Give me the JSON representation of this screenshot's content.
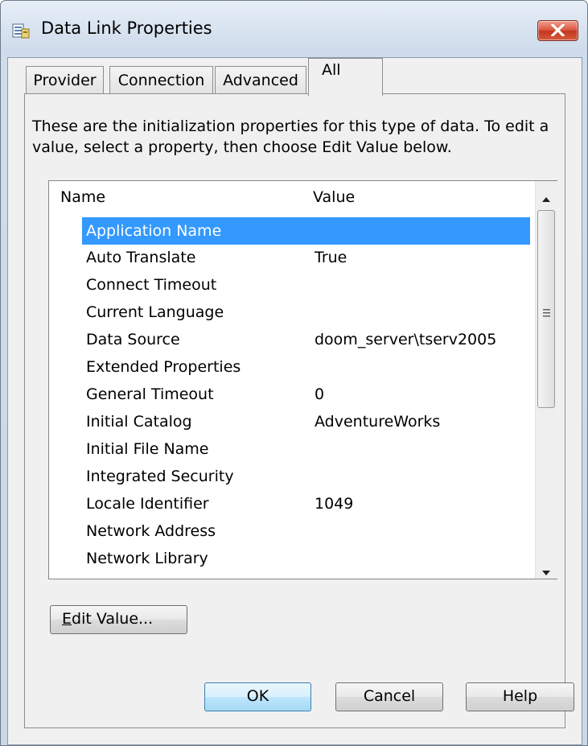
{
  "window": {
    "title": "Data Link Properties"
  },
  "tabs": [
    {
      "label": "Provider"
    },
    {
      "label": "Connection"
    },
    {
      "label": "Advanced"
    },
    {
      "label": "All",
      "active": true
    }
  ],
  "description": "These are the initialization properties for this type of data. To edit a value, select a property, then choose Edit Value below.",
  "properties": {
    "columns": [
      "Name",
      "Value"
    ],
    "rows": [
      {
        "name": "Application Name",
        "value": "",
        "selected": true
      },
      {
        "name": "Auto Translate",
        "value": "True"
      },
      {
        "name": "Connect Timeout",
        "value": ""
      },
      {
        "name": "Current Language",
        "value": ""
      },
      {
        "name": "Data Source",
        "value": "doom_server\\tserv2005"
      },
      {
        "name": "Extended Properties",
        "value": ""
      },
      {
        "name": "General Timeout",
        "value": "0"
      },
      {
        "name": "Initial Catalog",
        "value": "AdventureWorks"
      },
      {
        "name": "Initial File Name",
        "value": ""
      },
      {
        "name": "Integrated Security",
        "value": ""
      },
      {
        "name": "Locale Identifier",
        "value": "1049"
      },
      {
        "name": "Network Address",
        "value": ""
      },
      {
        "name": "Network Library",
        "value": ""
      }
    ]
  },
  "buttons": {
    "edit_value_mnemonic": "E",
    "edit_value_rest": "dit Value...",
    "ok": "OK",
    "cancel": "Cancel",
    "help": "Help"
  },
  "colors": {
    "selection": "#3399ff",
    "close_button": "#c3361f"
  },
  "icons": [
    "data-link-icon",
    "close-icon",
    "scroll-up-icon",
    "scroll-down-icon",
    "scroll-grip-icon"
  ]
}
